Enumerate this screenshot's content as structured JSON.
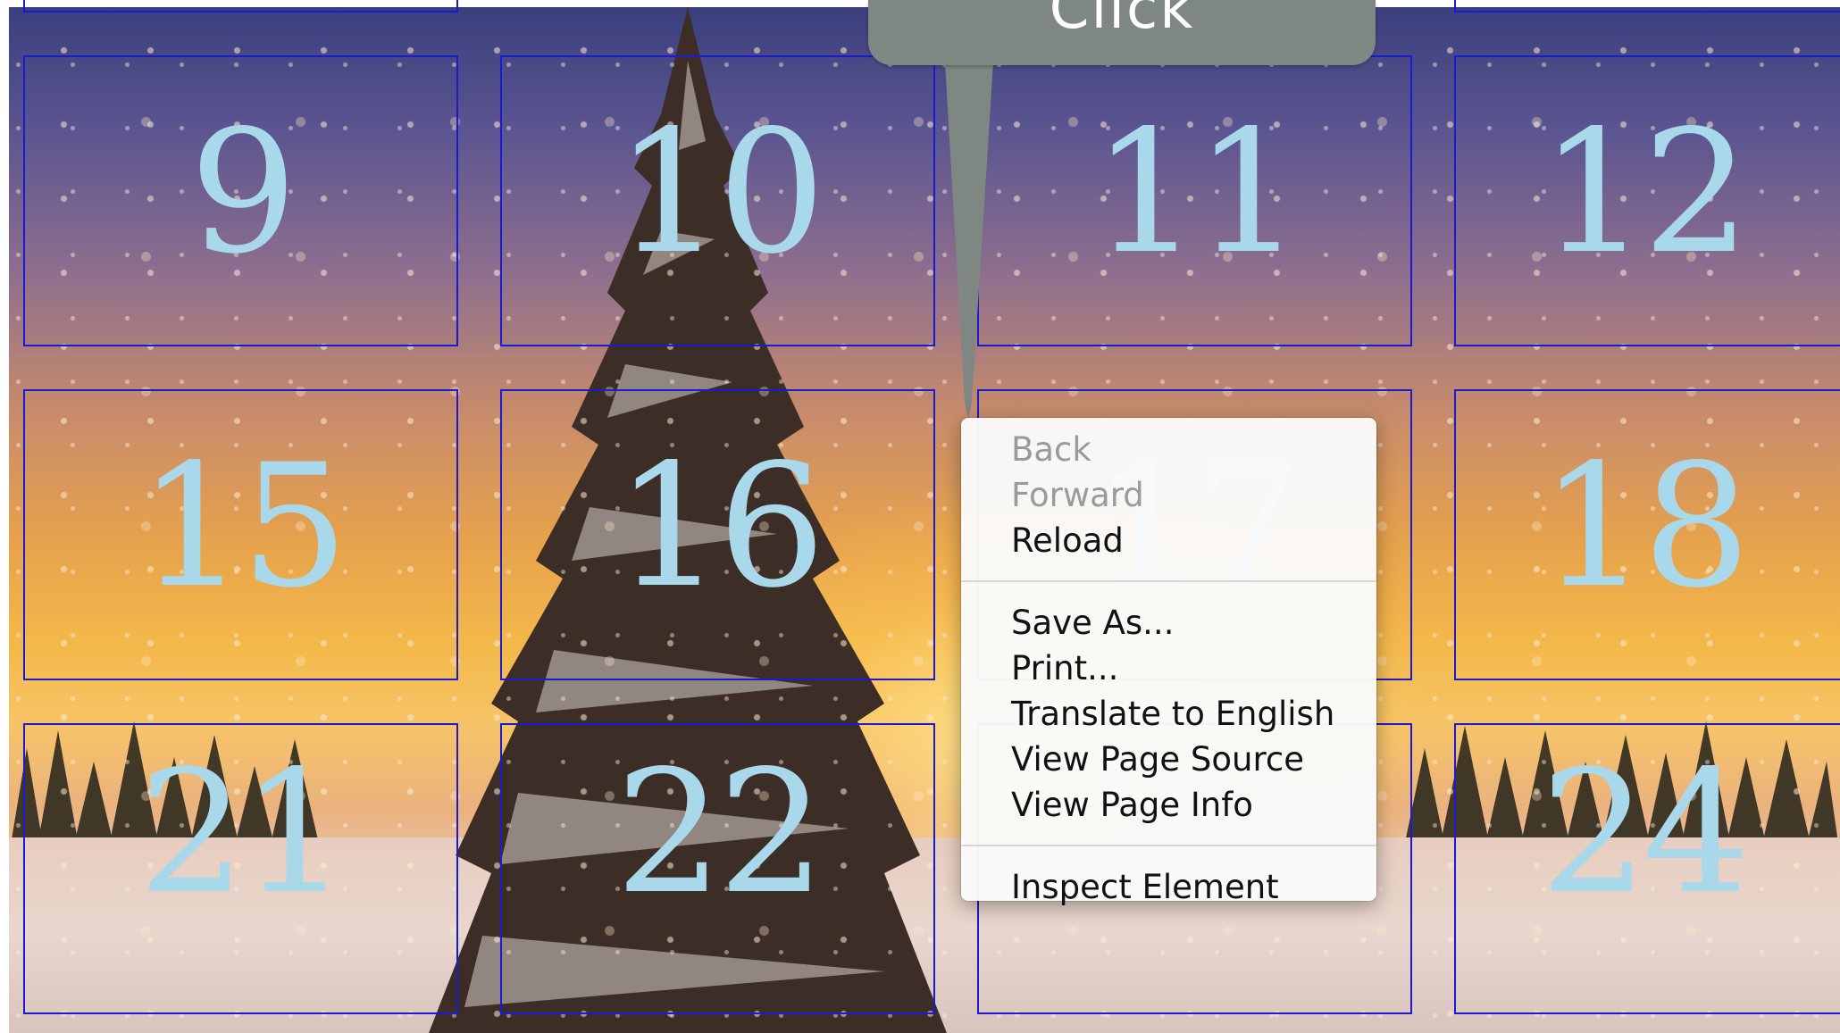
{
  "callout": {
    "label": "Click"
  },
  "calendar": {
    "rows": [
      [
        "9",
        "10",
        "11",
        "12"
      ],
      [
        "15",
        "16",
        "17",
        "18"
      ],
      [
        "21",
        "22",
        "23",
        "24"
      ]
    ]
  },
  "colors": {
    "grid_border": "#1a1ad0",
    "day_number": "#a9d8ea",
    "callout_bg": "#7f8783",
    "menu_bg": "#fafafa"
  },
  "context_menu": {
    "groups": [
      [
        {
          "label": "Back",
          "enabled": false
        },
        {
          "label": "Forward",
          "enabled": false
        },
        {
          "label": "Reload",
          "enabled": true
        }
      ],
      [
        {
          "label": "Save As...",
          "enabled": true
        },
        {
          "label": "Print...",
          "enabled": true
        },
        {
          "label": "Translate to English",
          "enabled": true
        },
        {
          "label": "View Page Source",
          "enabled": true
        },
        {
          "label": "View Page Info",
          "enabled": true
        }
      ],
      [
        {
          "label": "Inspect Element",
          "enabled": true
        }
      ]
    ]
  }
}
